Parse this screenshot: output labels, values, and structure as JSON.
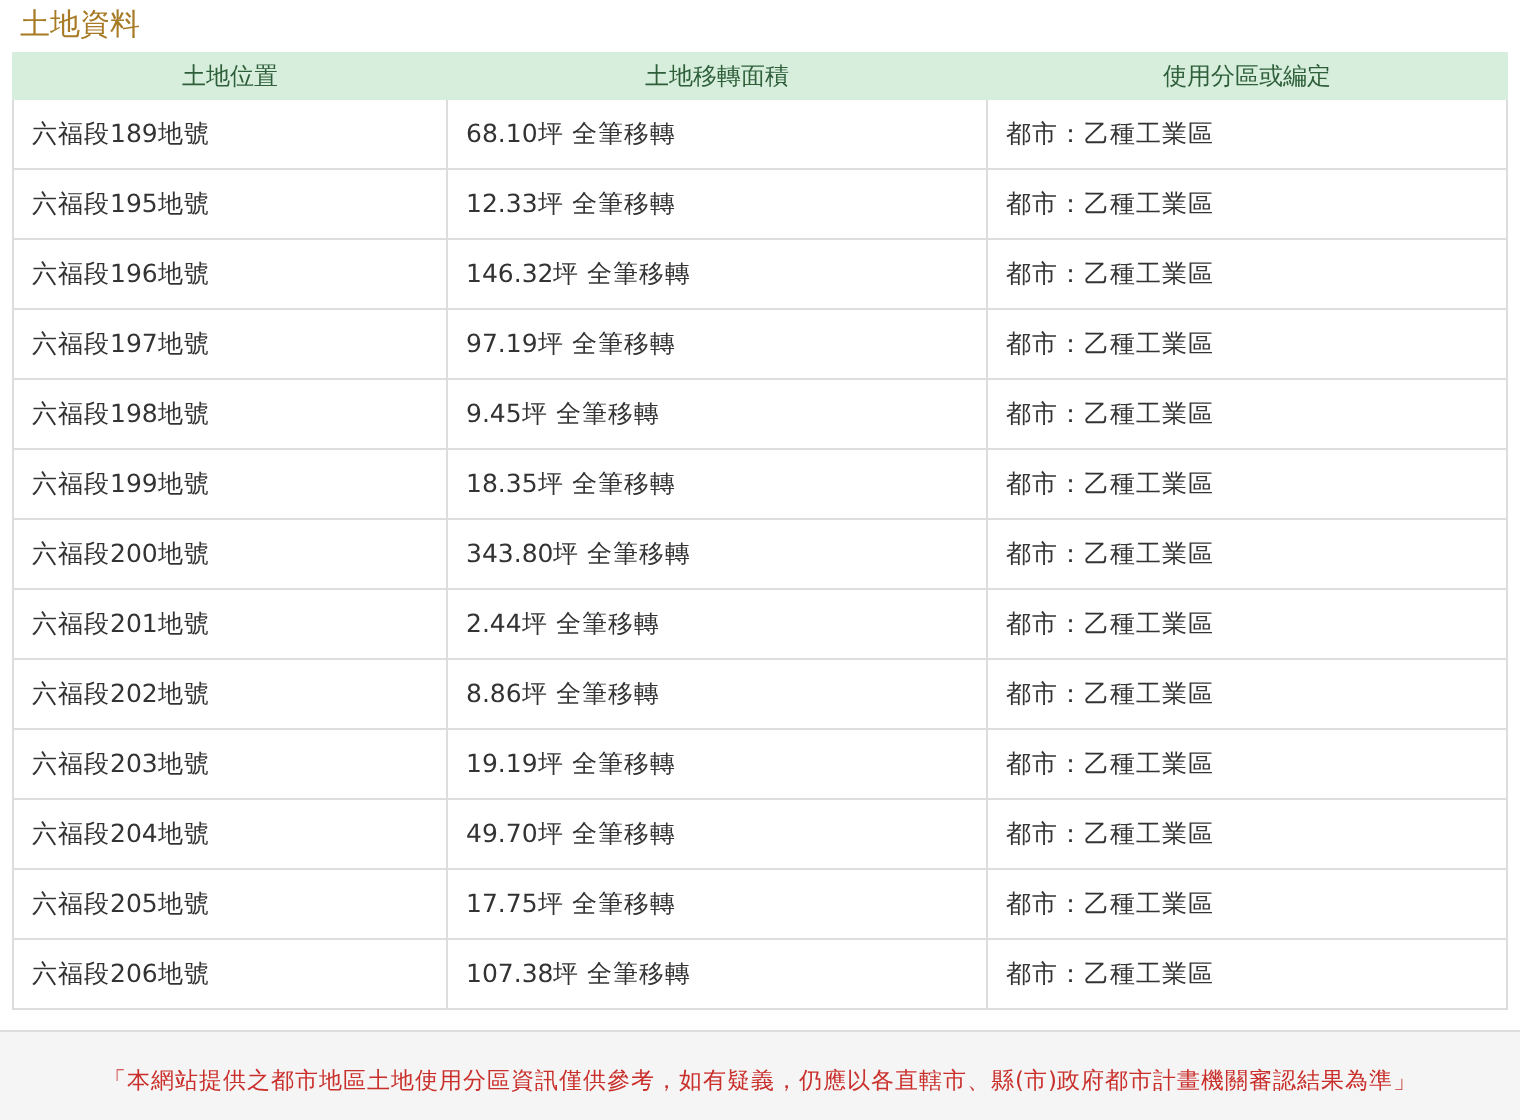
{
  "section_title": "土地資料",
  "table": {
    "columns": [
      "土地位置",
      "土地移轉面積",
      "使用分區或編定"
    ],
    "rows": [
      [
        "六福段189地號",
        "68.10坪 全筆移轉",
        "都市：乙種工業區"
      ],
      [
        "六福段195地號",
        "12.33坪 全筆移轉",
        "都市：乙種工業區"
      ],
      [
        "六福段196地號",
        "146.32坪 全筆移轉",
        "都市：乙種工業區"
      ],
      [
        "六福段197地號",
        "97.19坪 全筆移轉",
        "都市：乙種工業區"
      ],
      [
        "六福段198地號",
        "9.45坪 全筆移轉",
        "都市：乙種工業區"
      ],
      [
        "六福段199地號",
        "18.35坪 全筆移轉",
        "都市：乙種工業區"
      ],
      [
        "六福段200地號",
        "343.80坪 全筆移轉",
        "都市：乙種工業區"
      ],
      [
        "六福段201地號",
        "2.44坪 全筆移轉",
        "都市：乙種工業區"
      ],
      [
        "六福段202地號",
        "8.86坪 全筆移轉",
        "都市：乙種工業區"
      ],
      [
        "六福段203地號",
        "19.19坪 全筆移轉",
        "都市：乙種工業區"
      ],
      [
        "六福段204地號",
        "49.70坪 全筆移轉",
        "都市：乙種工業區"
      ],
      [
        "六福段205地號",
        "17.75坪 全筆移轉",
        "都市：乙種工業區"
      ],
      [
        "六福段206地號",
        "107.38坪 全筆移轉",
        "都市：乙種工業區"
      ]
    ]
  },
  "disclaimer": "「本網站提供之都市地區土地使用分區資訊僅供參考，如有疑義，仍應以各直轄市、縣(市)政府都市計畫機關審認結果為準」"
}
